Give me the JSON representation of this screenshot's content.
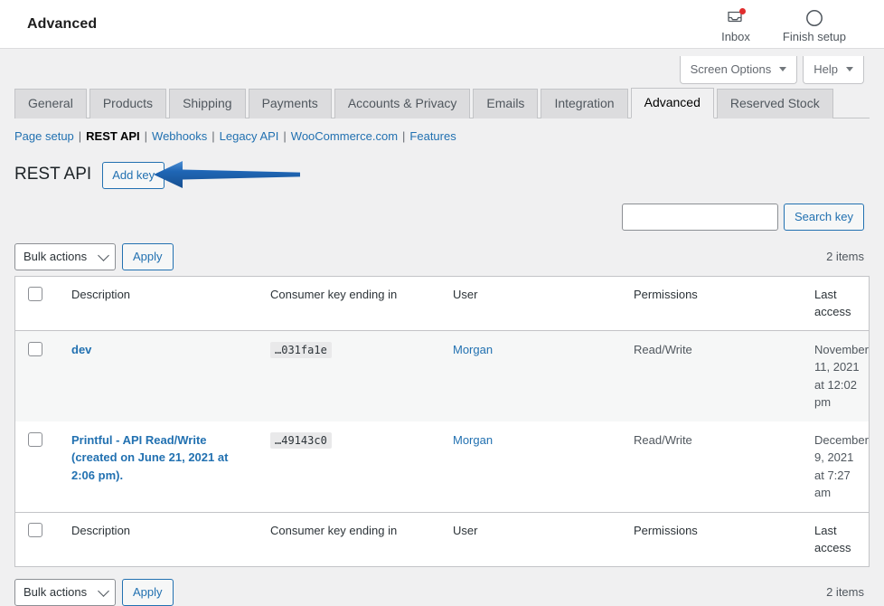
{
  "wc_header": {
    "title": "Advanced",
    "actions": [
      {
        "label": "Inbox",
        "icon": "inbox-icon",
        "has_badge": true
      },
      {
        "label": "Finish setup",
        "icon": "progress-circle-icon",
        "has_badge": false
      }
    ]
  },
  "screen_meta": {
    "screen_options_label": "Screen Options",
    "help_label": "Help"
  },
  "tabs": [
    {
      "label": "General",
      "active": false
    },
    {
      "label": "Products",
      "active": false
    },
    {
      "label": "Shipping",
      "active": false
    },
    {
      "label": "Payments",
      "active": false
    },
    {
      "label": "Accounts & Privacy",
      "active": false
    },
    {
      "label": "Emails",
      "active": false
    },
    {
      "label": "Integration",
      "active": false
    },
    {
      "label": "Advanced",
      "active": true
    },
    {
      "label": "Reserved Stock",
      "active": false
    }
  ],
  "subnav": [
    {
      "label": "Page setup",
      "current": false
    },
    {
      "label": "REST API",
      "current": true
    },
    {
      "label": "Webhooks",
      "current": false
    },
    {
      "label": "Legacy API",
      "current": false
    },
    {
      "label": "WooCommerce.com",
      "current": false
    },
    {
      "label": "Features",
      "current": false
    }
  ],
  "page": {
    "title": "REST API",
    "add_key_label": "Add key"
  },
  "search": {
    "value": "",
    "placeholder": "",
    "button_label": "Search key"
  },
  "tablenav": {
    "bulk_actions_label": "Bulk actions",
    "apply_label": "Apply",
    "items_count_top": "2 items",
    "items_count_bottom": "2 items"
  },
  "table": {
    "columns": [
      "Description",
      "Consumer key ending in",
      "User",
      "Permissions",
      "Last access"
    ],
    "rows": [
      {
        "description": "dev",
        "consumer_key": "…031fa1e",
        "user": "Morgan",
        "permissions": "Read/Write",
        "last_access": "November 11, 2021 at 12:02 pm"
      },
      {
        "description": "Printful - API Read/Write (created on June 21, 2021 at 2:06 pm).",
        "consumer_key": "…49143c0",
        "user": "Morgan",
        "permissions": "Read/Write",
        "last_access": "December 9, 2021 at 7:27 am"
      }
    ]
  },
  "annotation": {
    "type": "arrow-left",
    "color": "#1f66b5",
    "points_to": "add-key-button"
  },
  "colors": {
    "link": "#2271b1",
    "page_bg": "#f0f0f1",
    "badge": "#e02d2d",
    "arrow": "#1f66b5"
  }
}
